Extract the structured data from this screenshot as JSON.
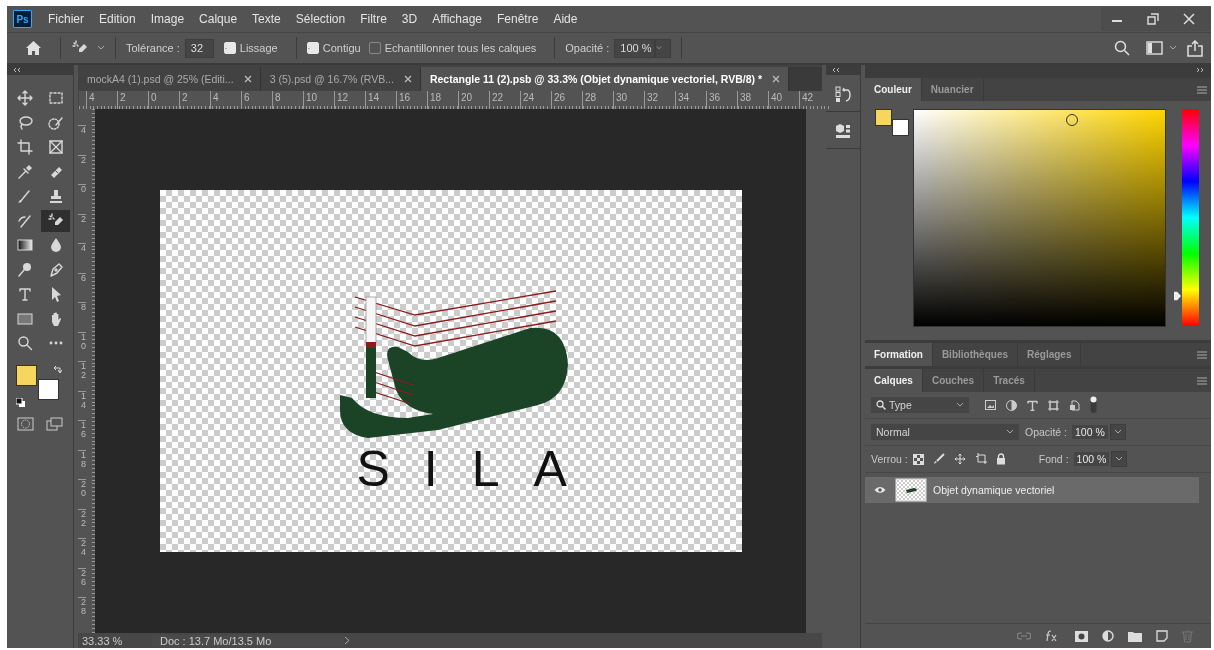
{
  "app_logo": "Ps",
  "menu": [
    "Fichier",
    "Edition",
    "Image",
    "Calque",
    "Texte",
    "Sélection",
    "Filtre",
    "3D",
    "Affichage",
    "Fenêtre",
    "Aide"
  ],
  "options_bar": {
    "tolerance_label": "Tolérance :",
    "tolerance": "32",
    "opacity_label": "Opacité :",
    "opacity": "100 %",
    "checkboxes": [
      {
        "label": "Lissage",
        "checked": true
      },
      {
        "label": "Contigu",
        "checked": true
      },
      {
        "label": "Echantillonner tous les calques",
        "checked": false
      }
    ]
  },
  "document_tabs": [
    {
      "title": "mockA4 (1).psd @ 25% (Editi...",
      "selected": false
    },
    {
      "title": "3 (5).psd @ 16.7% (RVB...",
      "selected": false
    },
    {
      "title": "Rectangle 11 (2).psb @ 33.3% (Objet dynamique vectoriel, RVB/8) *",
      "selected": true
    }
  ],
  "ruler_h": [
    "4",
    "2",
    "0",
    "2",
    "4",
    "6",
    "8",
    "10",
    "12",
    "14",
    "16",
    "18",
    "20",
    "22",
    "24",
    "26",
    "28",
    "30",
    "32",
    "34",
    "36",
    "38",
    "40",
    "42"
  ],
  "ruler_v": [
    "4",
    "2",
    "0",
    "2",
    "4",
    "6",
    "8",
    "10",
    "12",
    "14",
    "16",
    "18",
    "20",
    "22",
    "24",
    "26",
    "28"
  ],
  "document": {
    "logo_text": "SILA"
  },
  "status_bar": {
    "zoom": "33.33 %",
    "doc_info": "Doc : 13.7 Mo/13.5 Mo"
  },
  "tools": [
    {
      "kind": "move",
      "selected": false
    },
    {
      "kind": "marquee",
      "selected": false
    },
    {
      "kind": "lasso",
      "selected": false
    },
    {
      "kind": "quick-select",
      "selected": false
    },
    {
      "kind": "crop",
      "selected": false
    },
    {
      "kind": "frame",
      "selected": false
    },
    {
      "kind": "eyedropper",
      "selected": false
    },
    {
      "kind": "healing",
      "selected": false
    },
    {
      "kind": "brush",
      "selected": false
    },
    {
      "kind": "stamp",
      "selected": false
    },
    {
      "kind": "history-brush",
      "selected": false
    },
    {
      "kind": "magic-eraser",
      "selected": true
    },
    {
      "kind": "gradient",
      "selected": false
    },
    {
      "kind": "blur",
      "selected": false
    },
    {
      "kind": "dodge",
      "selected": false
    },
    {
      "kind": "pen",
      "selected": false
    },
    {
      "kind": "type",
      "selected": false
    },
    {
      "kind": "path-select",
      "selected": false
    },
    {
      "kind": "rectangle",
      "selected": false
    },
    {
      "kind": "hand",
      "selected": false
    },
    {
      "kind": "zoom",
      "selected": false
    },
    {
      "kind": "more",
      "selected": false
    }
  ],
  "swatches": [
    {
      "kind": "foreground",
      "color": "#f6d65c"
    },
    {
      "kind": "background",
      "color": "#ffffff"
    }
  ],
  "color_panel": {
    "tabs": [
      {
        "label": "Couleur",
        "selected": true
      },
      {
        "label": "Nuancier",
        "selected": false
      }
    ],
    "hue_slider": {
      "level": 0.14
    }
  },
  "learn_panel": {
    "tabs": [
      {
        "label": "Formation",
        "selected": true
      },
      {
        "label": "Bibliothèques",
        "selected": false
      },
      {
        "label": "Réglages",
        "selected": false
      }
    ]
  },
  "layers_panel": {
    "tabs": [
      {
        "label": "Calques",
        "selected": true
      },
      {
        "label": "Couches",
        "selected": false
      },
      {
        "label": "Tracés",
        "selected": false
      }
    ],
    "filter": "Type",
    "blend_mode": "Normal",
    "opacity_label": "Opacité :",
    "opacity": "100 %",
    "lock_label": "Verrou :",
    "fill_label": "Fond :",
    "fill": "100 %",
    "layers": [
      {
        "name": "Objet dynamique vectoriel",
        "visible": true,
        "selected": true
      }
    ]
  }
}
